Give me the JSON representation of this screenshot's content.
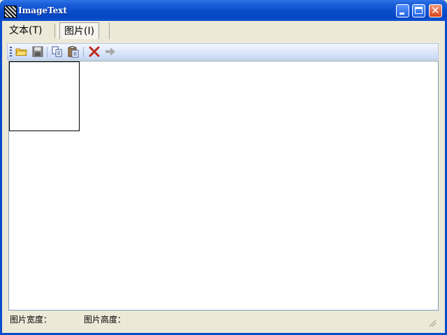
{
  "window": {
    "title": "ImageText",
    "accent": "#0a4dcb"
  },
  "tabs": [
    {
      "label": "文本(T)",
      "selected": false
    },
    {
      "label": "图片(I)",
      "selected": true
    }
  ],
  "toolbar": {
    "buttons": [
      {
        "icon": "open-folder-icon",
        "enabled": true
      },
      {
        "icon": "save-icon",
        "enabled": false
      },
      {
        "icon": "copy-icon",
        "enabled": true
      },
      {
        "icon": "paste-icon",
        "enabled": true
      },
      {
        "icon": "delete-icon",
        "enabled": true
      },
      {
        "icon": "forward-arrow-icon",
        "enabled": false
      }
    ]
  },
  "statusbar": {
    "width_label": "图片宽度：",
    "height_label": "图片高度："
  }
}
